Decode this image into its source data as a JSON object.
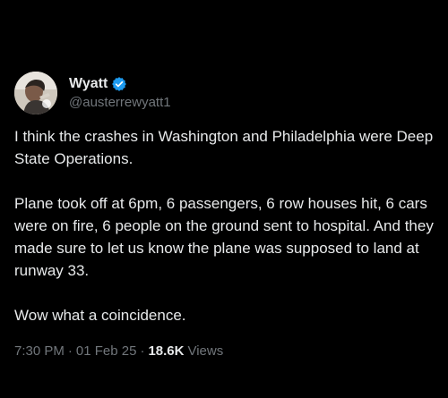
{
  "author": {
    "display_name": "Wyatt",
    "handle": "@austerrewyatt1",
    "verified": true,
    "verified_icon": "verified-badge-icon",
    "verified_color": "#1d9bf0"
  },
  "tweet": {
    "paragraphs": [
      "I think the crashes in Washington and Philadelphia were Deep State Operations.",
      "Plane took off at 6pm, 6 passengers, 6 row houses hit, 6 cars were on fire, 6 people on the ground sent to hospital. And they made sure to let us know the plane was supposed to land at runway 33.",
      "Wow what a coincidence."
    ],
    "time": "7:30 PM",
    "separator": "·",
    "date": "01 Feb 25",
    "views_count": "18.6K",
    "views_label": "Views"
  },
  "colors": {
    "background": "#000000",
    "primary_text": "#e7e9ea",
    "secondary_text": "#71767b"
  }
}
